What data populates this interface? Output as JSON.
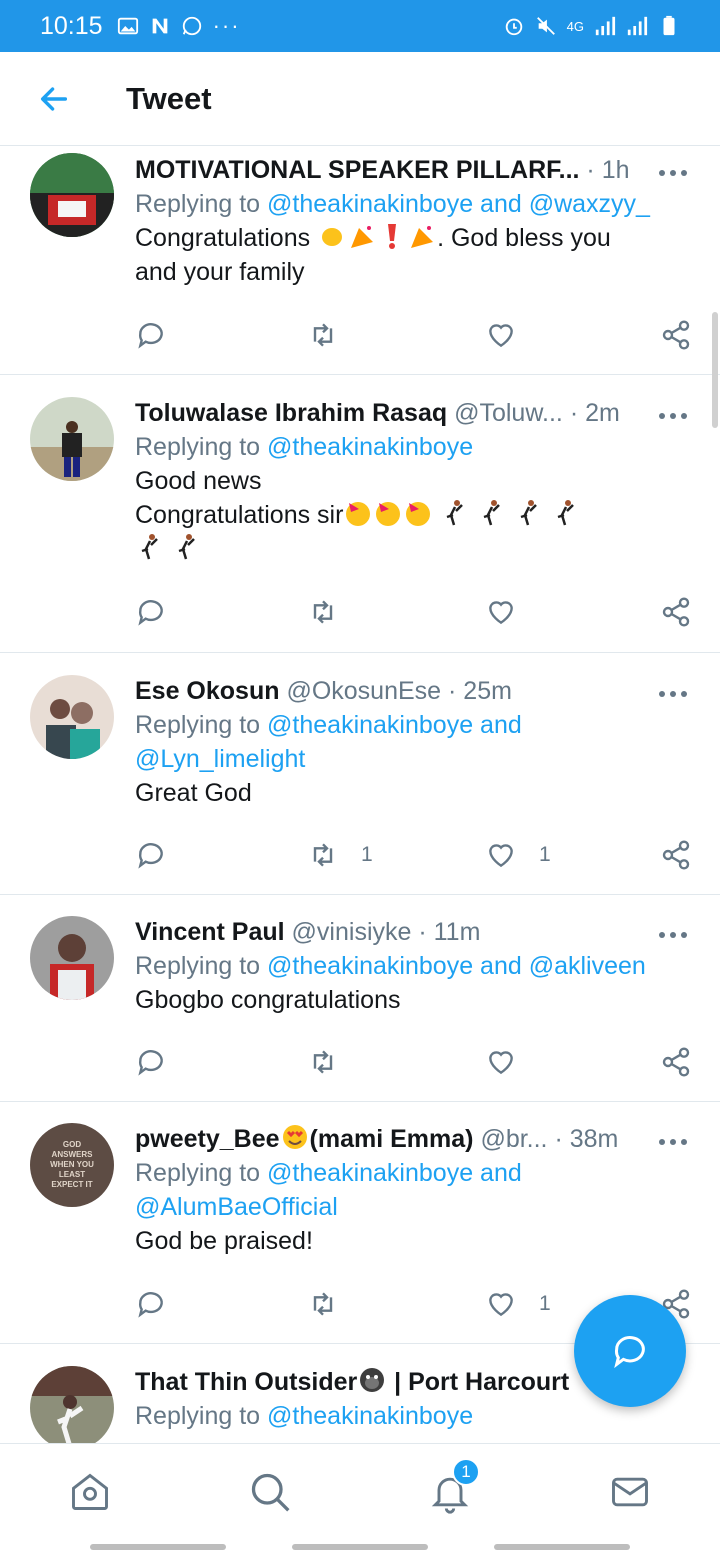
{
  "status_bar": {
    "time": "10:15",
    "network": "4G"
  },
  "header": {
    "title": "Tweet"
  },
  "tweets": [
    {
      "name": "MOTIVATIONAL SPEAKER PILLARF...",
      "handle": "",
      "time": "· 1h",
      "replying_label": "Replying to",
      "replying_to": "@theakinakinboye and @waxzyy_",
      "text_1": "Congratulations",
      "text_2": ". God bless you",
      "text_3": "and your family",
      "retweets": "",
      "likes": ""
    },
    {
      "name": "Toluwalase Ibrahim Rasaq",
      "handle": "@Toluw...",
      "time": "· 2m",
      "replying_label": "Replying to",
      "replying_to": "@theakinakinboye",
      "text_1": "Good news",
      "text_2": "Congratulations sir",
      "retweets": "",
      "likes": ""
    },
    {
      "name": "Ese Okosun",
      "handle": "@OkosunEse",
      "time": "· 25m",
      "replying_label": "Replying to",
      "replying_to_1": "@theakinakinboye and",
      "replying_to_2": "@Lyn_limelight",
      "text_1": "Great God",
      "retweets": "1",
      "likes": "1"
    },
    {
      "name": "Vincent Paul",
      "handle": "@vinisiyke",
      "time": "· 11m",
      "replying_label": "Replying to",
      "replying_to": "@theakinakinboye and @akliveen",
      "text_1": "Gbogbo congratulations",
      "retweets": "",
      "likes": ""
    },
    {
      "name_1": "pweety_Bee",
      "name_2": "(mami Emma)",
      "handle": "@br...",
      "time": "· 38m",
      "replying_label": "Replying to",
      "replying_to_1": "@theakinakinboye and",
      "replying_to_2": "@AlumBaeOfficial",
      "text_1": "God be praised!",
      "avatar_text": "GOD ANSWERS WHEN YOU LEAST EXPECT IT",
      "retweets": "",
      "likes": "1"
    },
    {
      "name_1": "That Thin Outsider",
      "name_2": " | Port Harcourt",
      "replying_label": "Replying to",
      "replying_to": "@theakinakinboye"
    }
  ],
  "notifications_badge": "1",
  "colors": {
    "accent": "#1da1f2",
    "status_bar": "#2196e8",
    "muted": "#657786"
  }
}
